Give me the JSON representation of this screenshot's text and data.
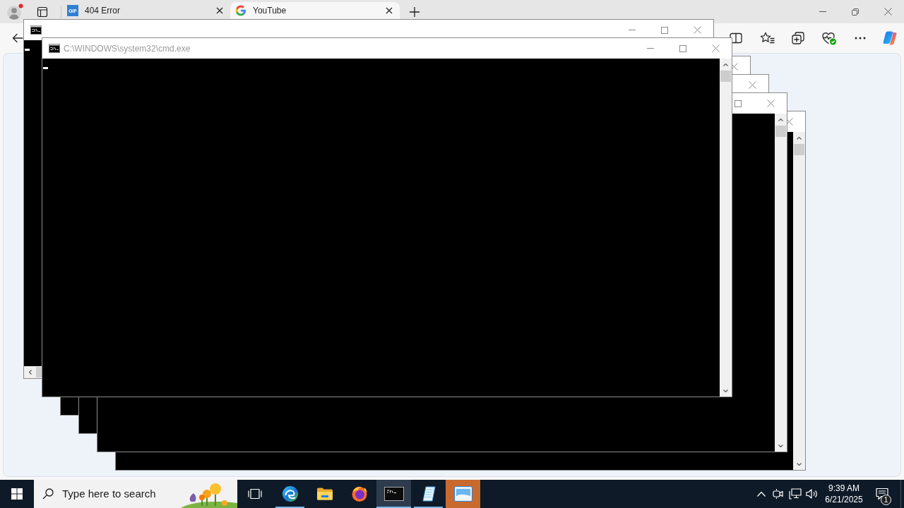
{
  "browser": {
    "tabs": [
      {
        "label": "404 Error",
        "favicon_text": "GIF",
        "selected": false
      },
      {
        "label": "YouTube",
        "selected": true
      }
    ]
  },
  "console_windows": [
    {
      "cursor": true
    },
    {
      "title": "C:\\WINDOWS\\system32\\cmd.exe",
      "active": false,
      "cursor": true
    }
  ],
  "taskbar": {
    "search": {
      "placeholder": "Type here to search"
    },
    "apps": [
      {
        "kind": "edge",
        "running": true,
        "active": false,
        "flashing": false
      },
      {
        "kind": "explorer",
        "running": false,
        "active": false,
        "flashing": false
      },
      {
        "kind": "firefox",
        "running": false,
        "active": false,
        "flashing": false
      },
      {
        "kind": "console",
        "running": true,
        "active": true,
        "flashing": false
      },
      {
        "kind": "notepad",
        "running": true,
        "active": false,
        "flashing": false
      },
      {
        "kind": "picture_window",
        "running": false,
        "active": false,
        "flashing": true
      }
    ],
    "clock": {
      "time": "9:39 AM",
      "date": "6/21/2025"
    },
    "notifications": {
      "count": "1"
    }
  }
}
